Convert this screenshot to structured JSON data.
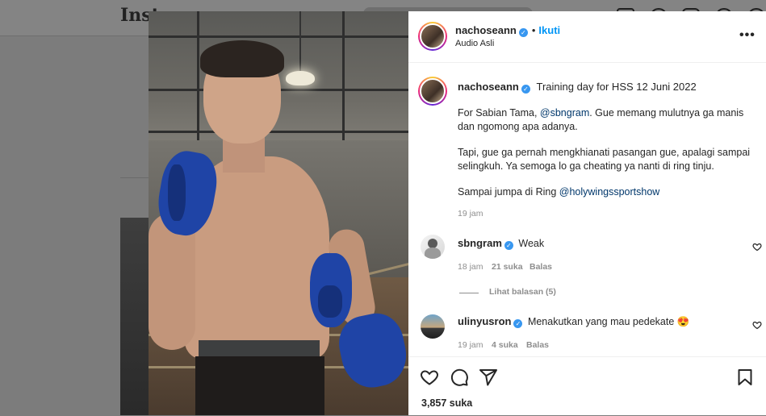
{
  "background": {
    "logo_text": "Inst"
  },
  "post": {
    "author": "nachoseann",
    "follow_label": "Ikuti",
    "separator": "•",
    "audio_label": "Audio Asli",
    "more_icon": "more-horizontal-icon"
  },
  "caption": {
    "author": "nachoseann",
    "title": "Training day for HSS 12 Juni 2022",
    "para1_prefix": "For Sabian Tama, ",
    "para1_mention": "@sbngram",
    "para1_suffix": ". Gue memang mulutnya ga manis dan ngomong apa adanya.",
    "para2": "Tapi, gue ga pernah mengkhianati pasangan gue, apalagi sampai selingkuh. Ya semoga lo ga cheating ya nanti di ring tinju.",
    "para3_prefix": "Sampai jumpa di Ring ",
    "para3_mention": "@holywingssportshow",
    "time": "19 jam"
  },
  "comments": [
    {
      "username": "sbngram",
      "text": "Weak",
      "time": "18 jam",
      "likes": "21 suka",
      "reply_label": "Balas",
      "view_replies": "Lihat balasan (5)"
    },
    {
      "username": "ulinyusron",
      "text": "Menakutkan yang mau pedekate 😍",
      "time": "19 jam",
      "likes": "4 suka",
      "reply_label": "Balas"
    }
  ],
  "actions": {
    "icons": [
      "heart-icon",
      "comment-icon",
      "share-icon",
      "bookmark-icon"
    ],
    "likes_count": "3,857 suka"
  },
  "colors": {
    "link": "#0095f6",
    "mention": "#00376b",
    "verified": "#3897f0",
    "glove": "#1f44a6"
  }
}
